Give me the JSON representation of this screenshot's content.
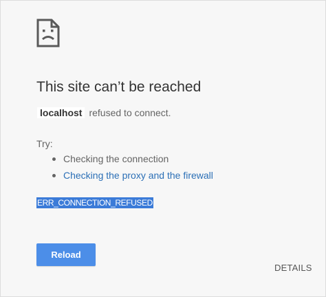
{
  "icon": {
    "name": "sad-page-icon"
  },
  "main": {
    "title": "This site can’t be reached",
    "host": "localhost",
    "summary_suffix": "refused to connect.",
    "try_label": "Try:",
    "suggestions": [
      {
        "label": "Checking the connection",
        "type": "text"
      },
      {
        "label": "Checking the proxy and the firewall",
        "type": "link"
      }
    ],
    "error_code": "ERR_CONNECTION_REFUSED"
  },
  "buttons": {
    "reload_label": "Reload",
    "details_label": "DETAILS"
  },
  "colors": {
    "background": "#f7f7f7",
    "title": "#333333",
    "body_text": "#646464",
    "link": "#2b6fb6",
    "primary_button": "#4c8ee8",
    "selection_highlight": "#3b7bd8"
  }
}
